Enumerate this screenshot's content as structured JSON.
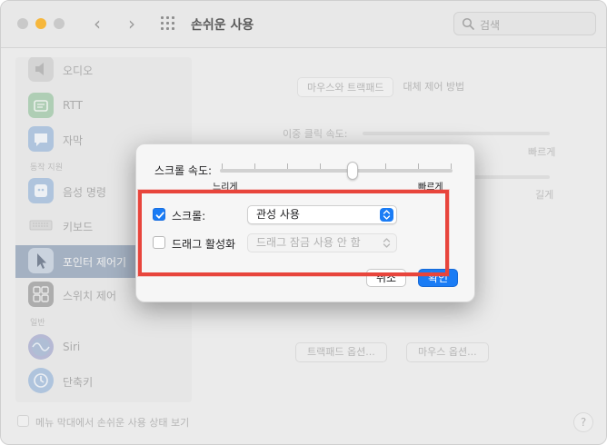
{
  "window": {
    "title": "손쉬운 사용",
    "search_placeholder": "검색"
  },
  "sidebar": {
    "items": [
      {
        "label": "오디오",
        "icon": "speaker-icon"
      },
      {
        "label": "RTT",
        "icon": "rtt-icon"
      },
      {
        "label": "자막",
        "icon": "captions-icon"
      },
      {
        "label": "음성 명령",
        "icon": "voice-control-icon"
      },
      {
        "label": "키보드",
        "icon": "keyboard-icon"
      },
      {
        "label": "포인터 제어기",
        "icon": "pointer-icon",
        "selected": true
      },
      {
        "label": "스위치 제어",
        "icon": "switch-control-icon"
      },
      {
        "label": "Siri",
        "icon": "siri-icon"
      },
      {
        "label": "단축키",
        "icon": "shortcut-icon"
      }
    ],
    "sections": {
      "motor": "동작 지원",
      "general": "일반"
    }
  },
  "pane": {
    "tabs": [
      "마우스와 트랙패드",
      "대체 제어 방법"
    ],
    "double_click_label": "이중 클릭 속도:",
    "fast_label": "빠르게",
    "long_label": "길게",
    "trackpad_options": "트랙패드 옵션...",
    "mouse_options": "마우스 옵션..."
  },
  "footer": {
    "show_status_label": "메뉴 막대에서 손쉬운 사용 상태 보기",
    "help": "?"
  },
  "sheet": {
    "scroll_speed_label": "스크롤 속도:",
    "slow_label": "느리게",
    "fast_label": "빠르게",
    "scroll_speed_value": 0.57,
    "scroll_checkbox_label": "스크롤:",
    "scroll_checked": true,
    "scroll_popup_value": "관성 사용",
    "drag_checkbox_label": "드래그 활성화",
    "drag_checked": false,
    "drag_popup_value": "드래그 잠금 사용 안 함",
    "cancel_label": "취소",
    "ok_label": "확인"
  },
  "colors": {
    "accent": "#1a7cf5",
    "highlight": "#e8453c",
    "sidebar_selected": "#7f93ad"
  }
}
